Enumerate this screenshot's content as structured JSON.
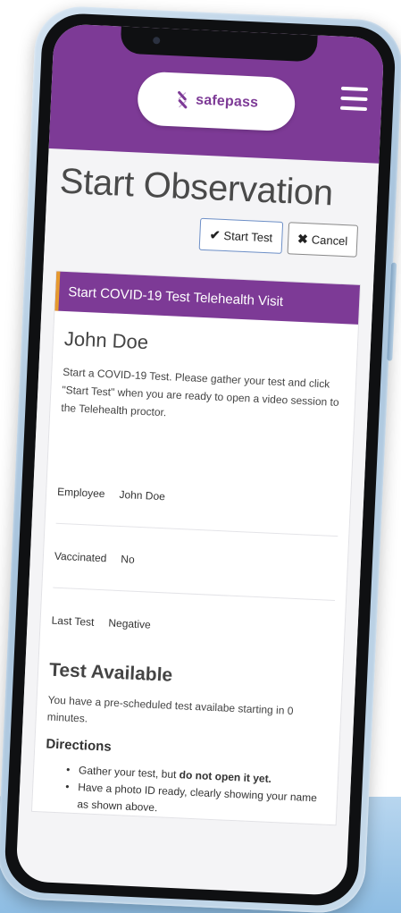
{
  "brand": {
    "name": "safepass",
    "color": "#7d3a96",
    "accent": "#e69a2e"
  },
  "header": {
    "menu_icon": "hamburger-menu-icon"
  },
  "page": {
    "title": "Start Observation",
    "start_button": "Start Test",
    "start_icon": "✔",
    "cancel_button": "Cancel",
    "cancel_icon": "✖"
  },
  "panel": {
    "header": "Start COVID-19 Test Telehealth Visit",
    "name": "John Doe",
    "intro": "Start a COVID-19 Test. Please gather your test and click \"Start Test\" when you are ready to open a video session to the Telehealth proctor.",
    "fields": [
      {
        "label": "Employee",
        "value": "John Doe"
      },
      {
        "label": "Vaccinated",
        "value": "No"
      },
      {
        "label": "Last Test",
        "value": "Negative"
      }
    ],
    "availability_title": "Test Available",
    "availability_text": "You have a pre-scheduled test availabe starting in 0 minutes.",
    "directions_title": "Directions",
    "directions": [
      {
        "pre": "Gather your test, but ",
        "bold": "do not open it yet.",
        "post": ""
      },
      {
        "pre": "Have a photo ID ready, clearly showing your name as shown above.",
        "bold": "",
        "post": ""
      }
    ]
  }
}
